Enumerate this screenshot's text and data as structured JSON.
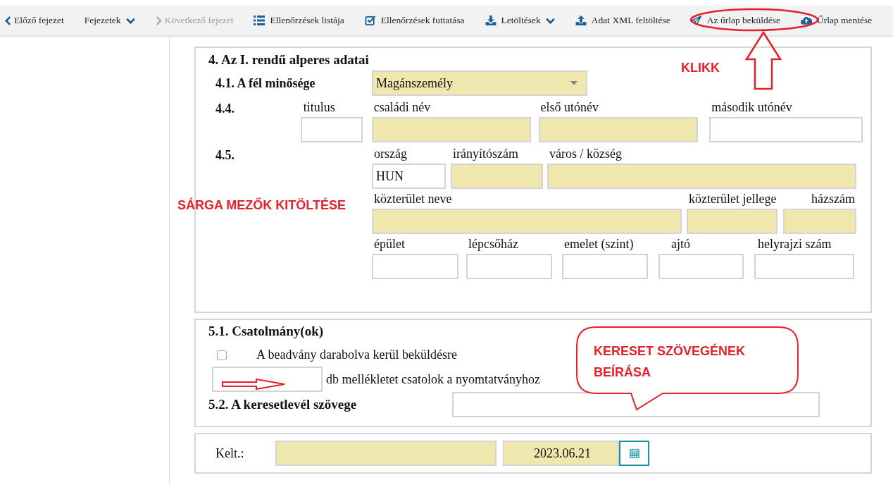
{
  "toolbar": [
    {
      "label": "Előző fejezet",
      "kind": "back",
      "disabled": false,
      "dropdown": false
    },
    {
      "label": "Fejezetek",
      "kind": "menu",
      "disabled": false,
      "dropdown": true
    },
    {
      "label": "Következő fejezet",
      "kind": "next",
      "disabled": true,
      "dropdown": false
    },
    {
      "label": "Ellenőrzések listája",
      "kind": "list",
      "disabled": false,
      "dropdown": false
    },
    {
      "label": "Ellenőrzések futtatása",
      "kind": "check",
      "disabled": false,
      "dropdown": false
    },
    {
      "label": "Letöltések",
      "kind": "download",
      "disabled": false,
      "dropdown": true
    },
    {
      "label": "Adat XML feltöltése",
      "kind": "upload",
      "disabled": false,
      "dropdown": false
    },
    {
      "label": "Az űrlap beküldése",
      "kind": "send",
      "disabled": false,
      "dropdown": false
    },
    {
      "label": "Űrlap mentése",
      "kind": "save",
      "disabled": false,
      "dropdown": false
    }
  ],
  "section4": {
    "title": "4. Az I. rendű alperes adatai",
    "quality": {
      "label": "4.1. A fél minősége",
      "value": "Magánszemély",
      "required": true
    },
    "rows": [
      {
        "label": "4.4.",
        "fields": [
          {
            "label": "titulus",
            "required": false
          },
          {
            "label": "családi név",
            "required": true
          },
          {
            "label": "első utónév",
            "required": true
          },
          {
            "label": "második utónév",
            "required": false
          }
        ]
      },
      {
        "label": "4.5.",
        "fields": [
          {
            "label": "ország",
            "value": "HUN",
            "required": false
          },
          {
            "label": "irányítószám",
            "required": true
          },
          {
            "label": "város / község",
            "required": true
          }
        ]
      },
      {
        "fields": [
          {
            "label": "közterület neve",
            "required": true
          },
          {
            "label": "közterület jellege",
            "required": true
          },
          {
            "label": "házszám",
            "required": true
          }
        ]
      },
      {
        "fields": [
          {
            "label": "épület",
            "required": false
          },
          {
            "label": "lépcsőház",
            "required": false
          },
          {
            "label": "emelet (szint)",
            "required": false
          },
          {
            "label": "ajtó",
            "required": false
          },
          {
            "label": "helyrajzi szám",
            "required": false
          }
        ]
      }
    ]
  },
  "section5": {
    "title": "5.1. Csatolmány(ok)",
    "split": {
      "label": "A beadvány darabolva kerül beküldésre",
      "checked": false
    },
    "attachments": {
      "label": "db mellékletet csatolok a nyomtatványhoz",
      "required": false
    },
    "text_field": {
      "label": "5.2. A keresetlevél szövege",
      "required": false
    }
  },
  "date_row": {
    "label": "Kelt.:",
    "place": {
      "required": true
    },
    "date": {
      "value": "2023.06.21",
      "required": true
    }
  },
  "annotations": [
    {
      "kind": "label",
      "text": "KLIKK"
    },
    {
      "kind": "label",
      "text": "SÁRGA MEZŐK KITÖLTÉSE"
    },
    {
      "kind": "callout",
      "text": "KERESET SZÖVEGÉNEK BEÍRÁSA"
    }
  ]
}
